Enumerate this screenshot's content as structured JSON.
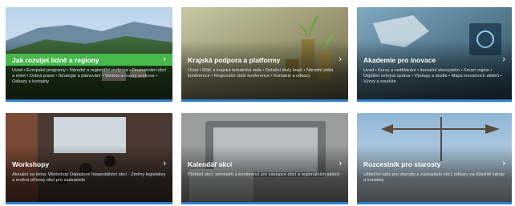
{
  "cards": [
    {
      "title": "Jak rozvíjet lidně a regiony",
      "description": "Úvod • Evropské programy • Národní a regionální podpora • Financování obcí a měst • Dobrá praxe • Strategie a plánování • Venkov a rozvoj venkova • Odkazy a kontakty",
      "accent": "#2e7fd1",
      "highlight": "#46b94b"
    },
    {
      "title": "Krajská podpora a platformy",
      "description": "Úvod • RSK a krajská tematická rada • Dotační tituly krajů • Národní stálá konference • Regionální stálé konference • Kontakty a odkazy",
      "accent": "#2e7fd1"
    },
    {
      "title": "Akademie pro inovace",
      "description": "Úvod • Kurzy a vzdělávání • Inovační ekosystém • Smart region • Digitální veřejná správa • Výstupy a studie • Mapa inovačních aktérů • Výzvy a soutěže",
      "accent": "#2e7fd1"
    },
    {
      "title": "Workshopy",
      "description": "Aktuální na téma: Workshop Odpadové hospodářství obcí - Změny legislativy a možné přínosy obcí pro zastupitele",
      "accent": "#2e7fd1"
    },
    {
      "title": "Kalendář akcí",
      "description": "Přehled akcí, seminářů a konferencí pro zástupce obcí a regionálních aktérů",
      "accent": "#2e7fd1"
    },
    {
      "title": "Rozcestník pro starosty",
      "description": "Užitečné rady pro starosty a zastupitele obcí, odkazy na důležité zdroje a kontakty",
      "accent": "#2e7fd1"
    }
  ],
  "colors": {
    "accent": "#2e7fd1",
    "green": "#46b94b"
  }
}
